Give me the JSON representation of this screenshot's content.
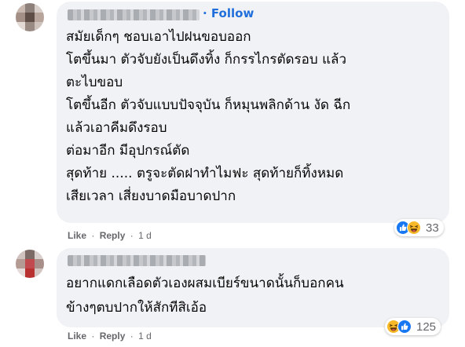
{
  "comments": [
    {
      "follow_label": "Follow",
      "lines": [
        "สมัยเด็กๆ ชอบเอาไปฝนขอบออก",
        "โตขึ้นมา ตัวจับยังเป็นดึงทิ้ง ก็กรรไกรตัดรอบ แล้ว",
        "ตะไบขอบ",
        "โตขึ้นอีก ตัวจับแบบปัจจุบัน ก็หมุนพลิกด้าน งัด ฉีก",
        "แล้วเอาคีมดึงรอบ",
        "ต่อมาอีก มีอุปกรณ์ตัด",
        "สุดท้าย ..... ตรูจะตัดฝาทำไมฟะ สุดท้ายก็ทิ้งหมด",
        "เสียเวลา เสี่ยงบาดมือบาดปาก"
      ],
      "actions": {
        "like": "Like",
        "reply": "Reply",
        "separator": "·",
        "time": "1 d"
      },
      "reactions": {
        "icons": [
          "like-icon",
          "haha-icon"
        ],
        "count": "33"
      }
    },
    {
      "lines": [
        "อยากแดกเลือดตัวเองผสมเบียร์ขนาดนั้นก็บอกคน",
        "ข้างๆตบปากให้สักทีสิเอ้อ"
      ],
      "actions": {
        "like": "Like",
        "reply": "Reply",
        "separator": "·",
        "time": "1 d"
      },
      "reactions": {
        "icons": [
          "haha-icon",
          "like-icon"
        ],
        "count": "125"
      }
    }
  ],
  "colors": {
    "bubble": "#f0f2f5",
    "link": "#216fdb",
    "meta": "#65676b",
    "like": "#1877f2",
    "haha": "#f7b928"
  }
}
